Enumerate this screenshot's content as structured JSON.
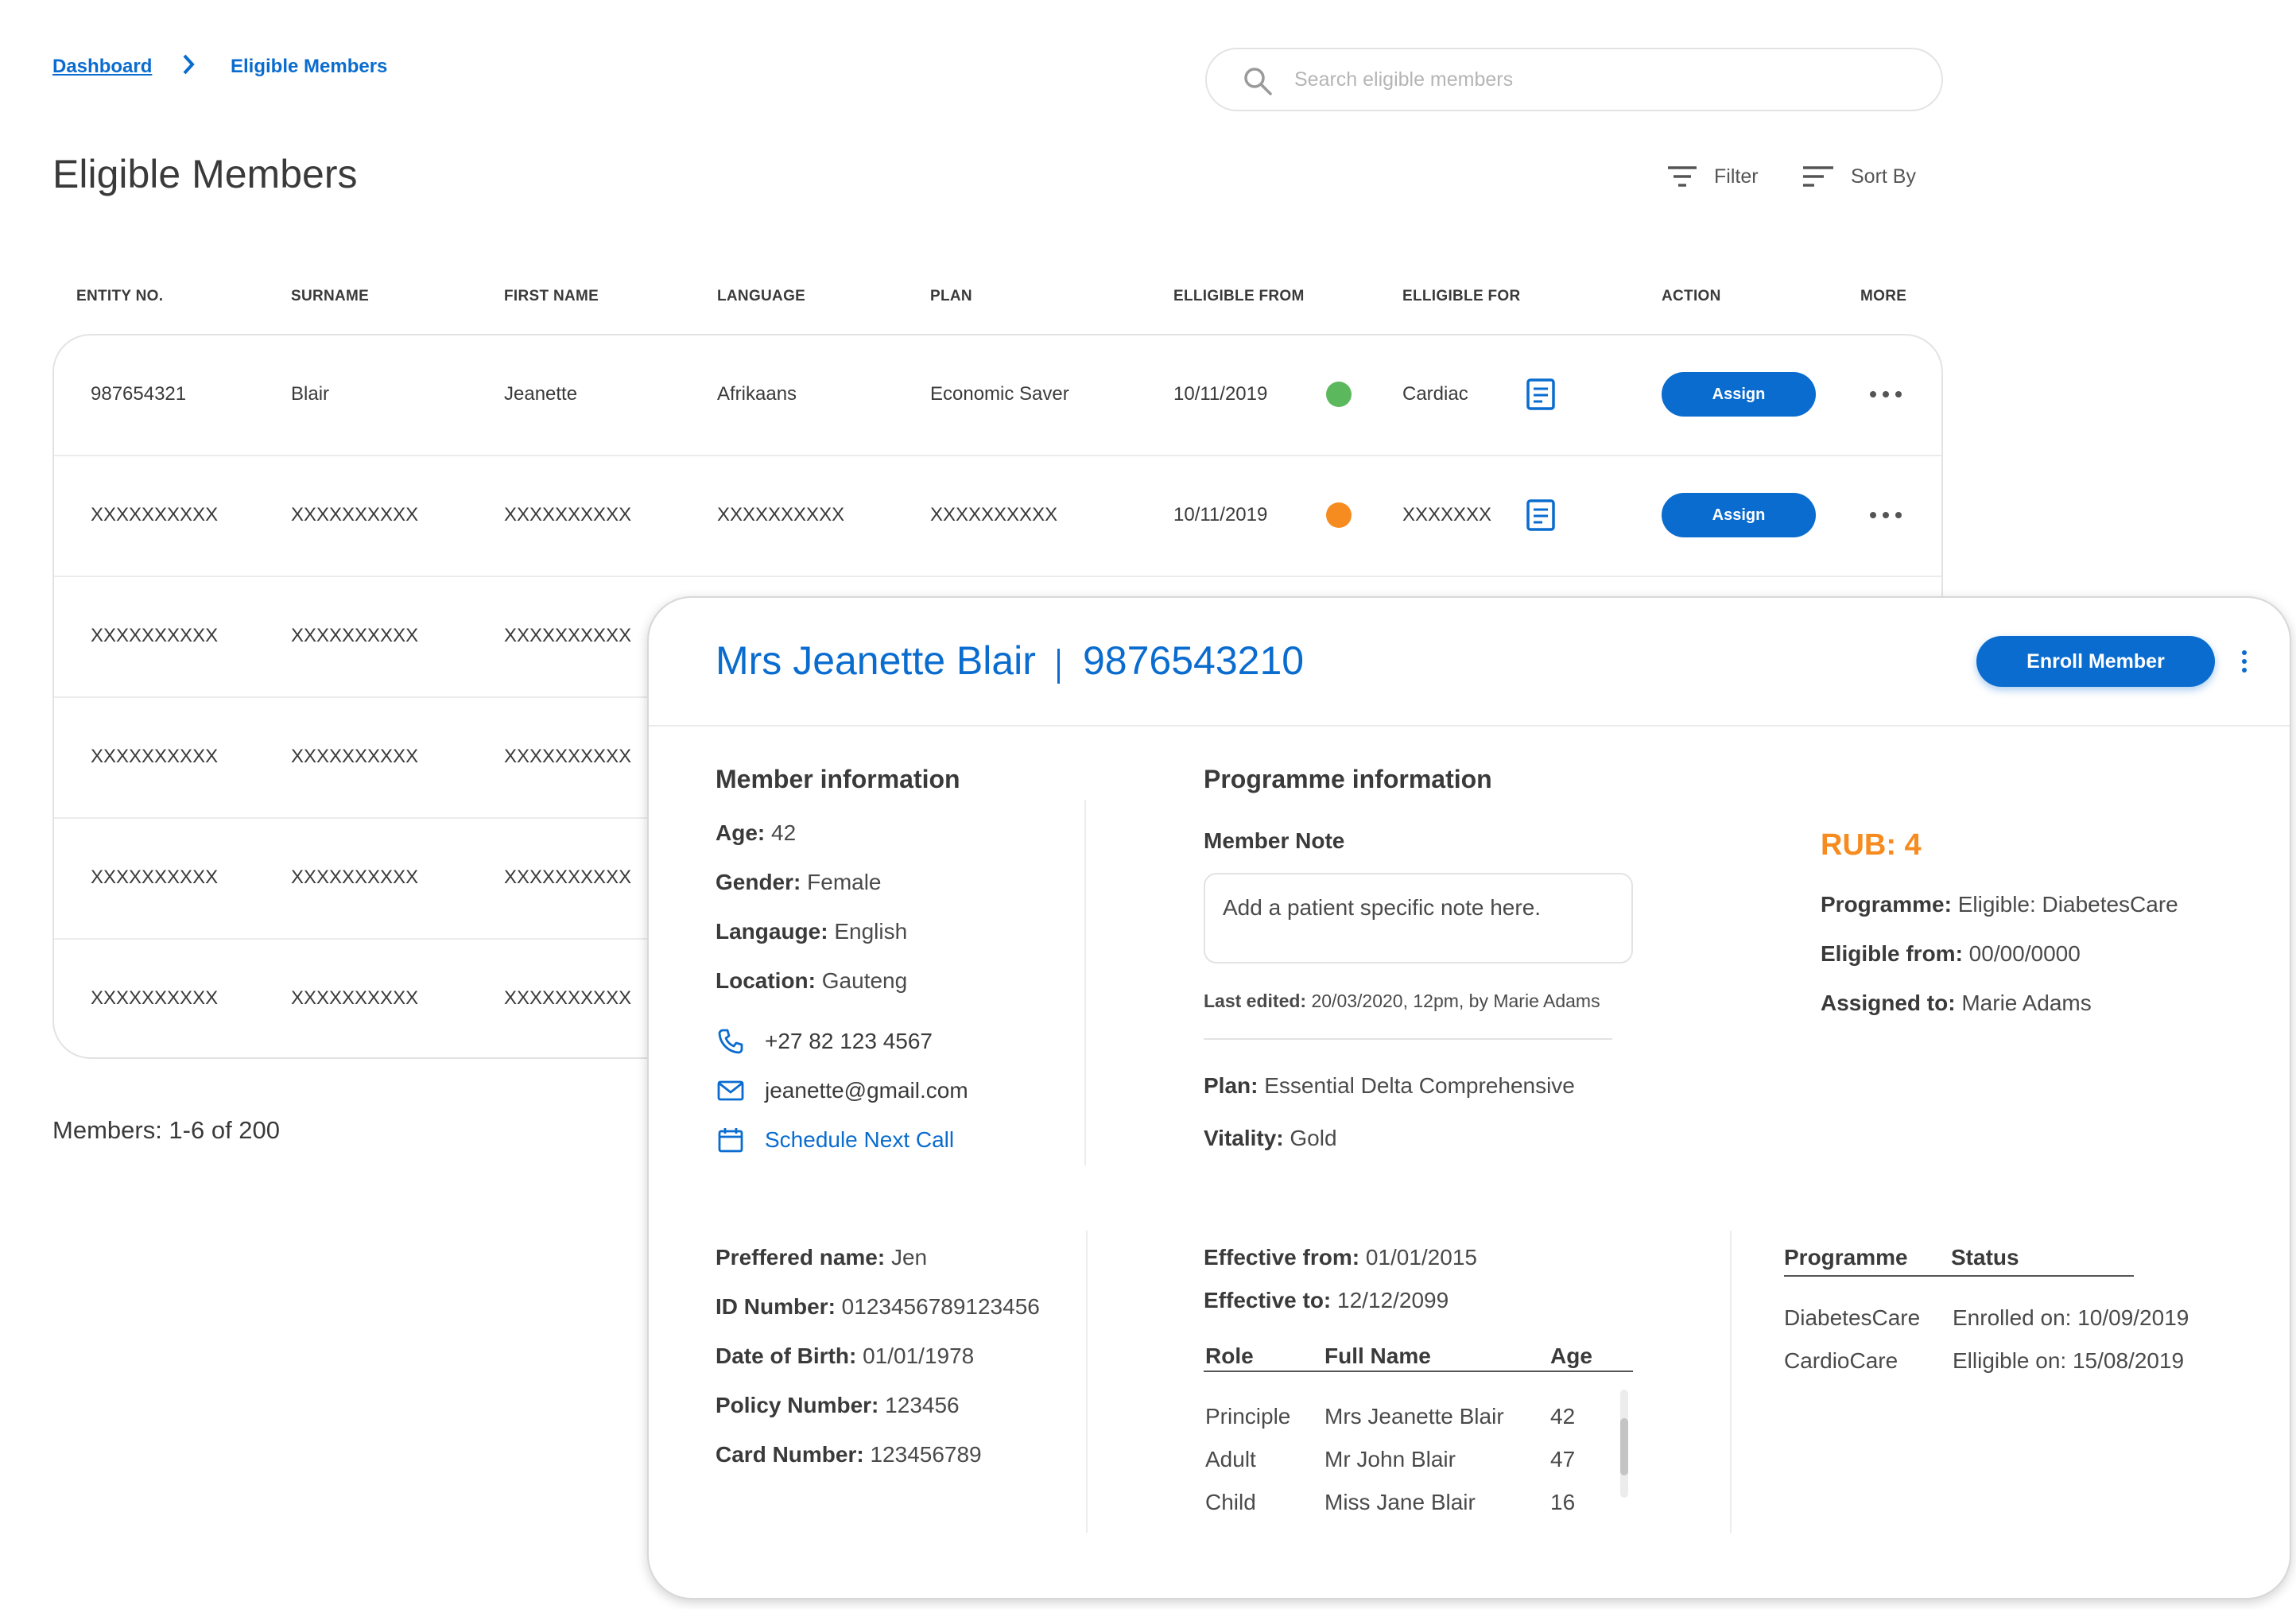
{
  "breadcrumb": {
    "home": "Dashboard",
    "current": "Eligible Members"
  },
  "search": {
    "placeholder": "Search eligible members"
  },
  "page": {
    "title": "Eligible Members"
  },
  "toolbar": {
    "filter": "Filter",
    "sort": "Sort By"
  },
  "table": {
    "headers": [
      "ENTITY NO.",
      "SURNAME",
      "FIRST NAME",
      "LANGUAGE",
      "PLAN",
      "ELLIGIBLE FROM",
      "ELLIGIBLE FOR",
      "ACTION",
      "MORE"
    ],
    "assign_label": "Assign",
    "rows": [
      {
        "entity": "987654321",
        "surname": "Blair",
        "first": "Jeanette",
        "language": "Afrikaans",
        "plan": "Economic Saver",
        "from": "10/11/2019",
        "status_color": "#5cb85c",
        "for": "Cardiac"
      },
      {
        "entity": "XXXXXXXXXX",
        "surname": "XXXXXXXXXX",
        "first": "XXXXXXXXXX",
        "language": "XXXXXXXXXX",
        "plan": "XXXXXXXXXX",
        "from": "10/11/2019",
        "status_color": "#f68b1f",
        "for": "XXXXXXX"
      },
      {
        "entity": "XXXXXXXXXX",
        "surname": "XXXXXXXXXX",
        "first": "XXXXXXXXXX"
      },
      {
        "entity": "XXXXXXXXXX",
        "surname": "XXXXXXXXXX",
        "first": "XXXXXXXXXX"
      },
      {
        "entity": "XXXXXXXXXX",
        "surname": "XXXXXXXXXX",
        "first": "XXXXXXXXXX"
      },
      {
        "entity": "XXXXXXXXXX",
        "surname": "XXXXXXXXXX",
        "first": "XXXXXXXXXX"
      }
    ],
    "footer": "Members: 1-6 of 200"
  },
  "panel": {
    "name": "Mrs Jeanette Blair",
    "number": "9876543210",
    "enroll_label": "Enroll Member",
    "member_info": {
      "title": "Member information",
      "age_label": "Age:",
      "age": " 42",
      "gender_label": "Gender:",
      "gender": " Female",
      "language_label": "Langauge:",
      "language": " English",
      "location_label": "Location:",
      "location": " Gauteng",
      "phone": "+27 82 123 4567",
      "email": "jeanette@gmail.com",
      "schedule": "Schedule Next Call"
    },
    "programme_info": {
      "title": "Programme information",
      "note_label": "Member Note",
      "note_placeholder": "Add a patient specific note here.",
      "last_edited_label": "Last edited:",
      "last_edited": " 20/03/2020, 12pm, by Marie Adams",
      "plan_label": "Plan:",
      "plan": " Essential Delta Comprehensive",
      "vitality_label": "Vitality:",
      "vitality": " Gold"
    },
    "rub": "RUB: 4",
    "summary": {
      "programme_label": "Programme:",
      "programme": " Eligible: DiabetesCare",
      "eligible_from_label": "Eligible from:",
      "eligible_from": " 00/00/0000",
      "assigned_label": "Assigned to:",
      "assigned": " Marie Adams"
    },
    "details": {
      "preferred_label": "Preffered name:",
      "preferred": " Jen",
      "id_label": "ID Number:",
      "id": " 0123456789123456",
      "dob_label": "Date of Birth:",
      "dob": " 01/01/1978",
      "policy_label": "Policy Number:",
      "policy": " 123456",
      "card_label": "Card Number:",
      "card": " 123456789"
    },
    "effective": {
      "from_label": "Effective from:",
      "from": " 01/01/2015",
      "to_label": "Effective to:",
      "to": " 12/12/2099"
    },
    "dependants": {
      "headers": [
        "Role",
        "Full Name",
        "Age"
      ],
      "rows": [
        [
          "Principle",
          "Mrs Jeanette Blair",
          "42"
        ],
        [
          "Adult",
          "Mr John Blair",
          "47"
        ],
        [
          "Child",
          "Miss Jane Blair",
          "16"
        ]
      ]
    },
    "programmes": {
      "headers": [
        "Programme",
        "Status"
      ],
      "rows": [
        [
          "DiabetesCare",
          "Enrolled on: 10/09/2019"
        ],
        [
          "CardioCare",
          "Elligible on: 15/08/2019"
        ]
      ]
    }
  },
  "colors": {
    "accent": "#0a6ccf",
    "rub": "#f68b1f",
    "green": "#5cb85c",
    "orange": "#f68b1f"
  }
}
